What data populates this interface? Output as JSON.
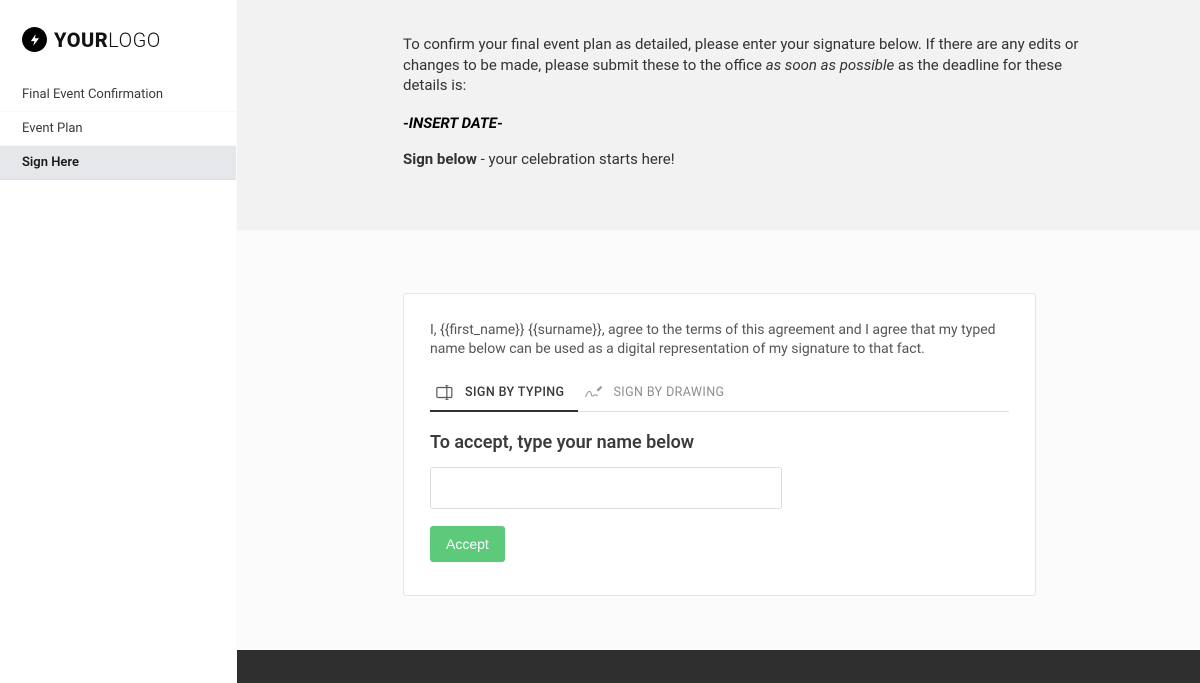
{
  "logo": {
    "bold": "YOUR",
    "light": "LOGO"
  },
  "sidebar": {
    "items": [
      {
        "label": "Final Event Confirmation"
      },
      {
        "label": "Event Plan"
      },
      {
        "label": "Sign Here"
      }
    ]
  },
  "intro": {
    "part1": "To confirm your final event plan as detailed, please enter your signature below.  If there are any edits or changes to be made, please submit these to the office ",
    "italic": "as soon as possible",
    "part2": " as the deadline for these details is:",
    "insert_date": "-INSERT DATE-",
    "sign_bold": "Sign below",
    "sign_rest": " - your celebration starts here!"
  },
  "signature": {
    "agreement": "I, {{first_name}} {{surname}}, agree to the terms of this agreement and I agree that my typed name below can be used as a digital representation of my signature to that fact.",
    "tab_typing": "SIGN BY TYPING",
    "tab_drawing": "SIGN BY DRAWING",
    "accept_prompt": "To accept, type your name below",
    "input_value": "",
    "input_placeholder": "",
    "accept_button": "Accept"
  }
}
